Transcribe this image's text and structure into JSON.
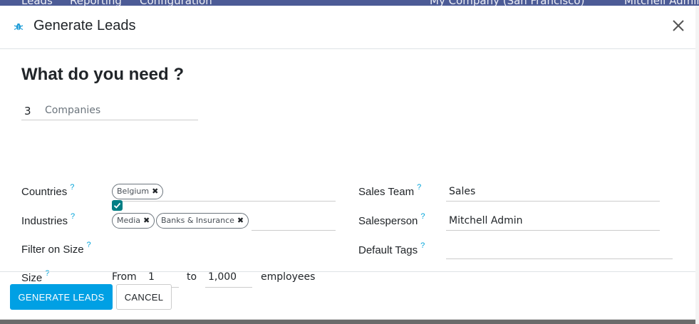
{
  "background": {
    "nav_items": [
      "Leads",
      "Reporting",
      "Configuration"
    ],
    "company": "My Company (San Francisco)",
    "user": "Mitchell Admin"
  },
  "modal": {
    "title": "Generate Leads",
    "logo_icon": "bug-icon",
    "close_icon": "close-icon"
  },
  "form": {
    "heading": "What do you need ?",
    "count": "3",
    "count_unit": "Companies",
    "help_marker": "?",
    "countries": {
      "label": "Countries",
      "tags": [
        "Belgium"
      ]
    },
    "industries": {
      "label": "Industries",
      "tags": [
        "Media",
        "Banks & Insurance"
      ]
    },
    "filter_on_size": {
      "label": "Filter on Size",
      "checked": true
    },
    "size": {
      "label": "Size",
      "from_label": "From",
      "from_value": "1",
      "to_label": "to",
      "to_value": "1,000",
      "unit": "employees"
    },
    "sales_team": {
      "label": "Sales Team",
      "value": "Sales"
    },
    "salesperson": {
      "label": "Salesperson",
      "value": "Mitchell Admin"
    },
    "default_tags": {
      "label": "Default Tags",
      "value": ""
    }
  },
  "footer": {
    "primary_label": "GENERATE LEADS",
    "secondary_label": "CANCEL"
  },
  "colors": {
    "primary": "#00a0e4",
    "checkbox": "#017e84",
    "help": "#00a3d9"
  }
}
